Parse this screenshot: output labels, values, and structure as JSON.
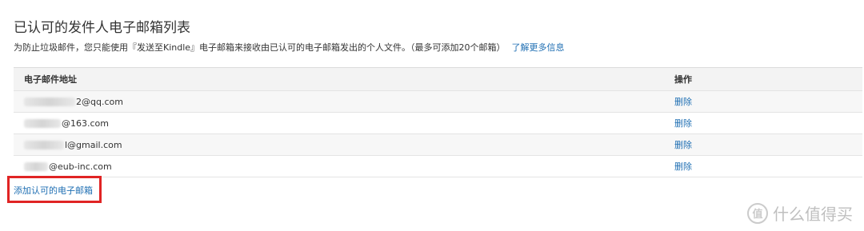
{
  "page": {
    "title": "已认可的发件人电子邮箱列表",
    "description": "为防止垃圾邮件，您只能使用『发送至Kindle』电子邮箱来接收由已认可的电子邮箱发出的个人文件。（最多可添加20个邮箱）",
    "learn_more": "了解更多信息"
  },
  "table": {
    "col_email": "电子邮件地址",
    "col_ops": "操作",
    "rows": [
      {
        "email_suffix": "2@qq.com",
        "action": "删除"
      },
      {
        "email_suffix": "@163.com",
        "action": "删除"
      },
      {
        "email_suffix": "l@gmail.com",
        "action": "删除"
      },
      {
        "email_suffix": "@eub-inc.com",
        "action": "删除"
      }
    ]
  },
  "add_link": "添加认可的电子邮箱",
  "watermark": {
    "mark": "值",
    "text": "什么值得买"
  },
  "colors": {
    "link": "#1f6fb3",
    "highlight": "#e02424",
    "header_bg": "#f3f3f3"
  }
}
